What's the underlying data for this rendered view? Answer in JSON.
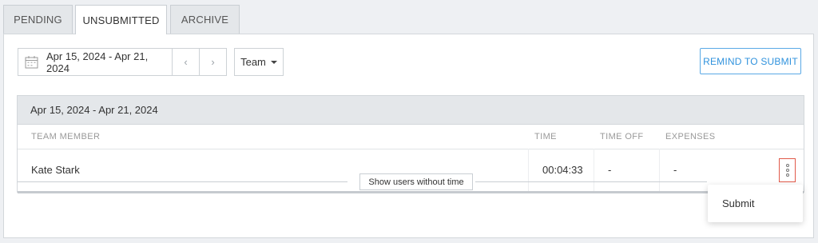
{
  "tabs": [
    {
      "label": "PENDING"
    },
    {
      "label": "UNSUBMITTED"
    },
    {
      "label": "ARCHIVE"
    }
  ],
  "filters": {
    "date_range": "Apr 15, 2024 - Apr 21, 2024",
    "prev_icon": "‹",
    "next_icon": "›",
    "team_label": "Team",
    "remind_label": "REMIND TO SUBMIT"
  },
  "table": {
    "group_title": "Apr 15, 2024 - Apr 21, 2024",
    "columns": {
      "member": "TEAM MEMBER",
      "time": "TIME",
      "time_off": "TIME OFF",
      "expenses": "EXPENSES"
    },
    "rows": [
      {
        "member": "Kate Stark",
        "time": "00:04:33",
        "time_off": "-",
        "expenses": "-"
      }
    ]
  },
  "show_users_label": "Show users without time",
  "menu": {
    "items": [
      {
        "label": "Submit"
      }
    ]
  },
  "colors": {
    "accent": "#2f92dd",
    "highlight": "#e15a4a"
  }
}
